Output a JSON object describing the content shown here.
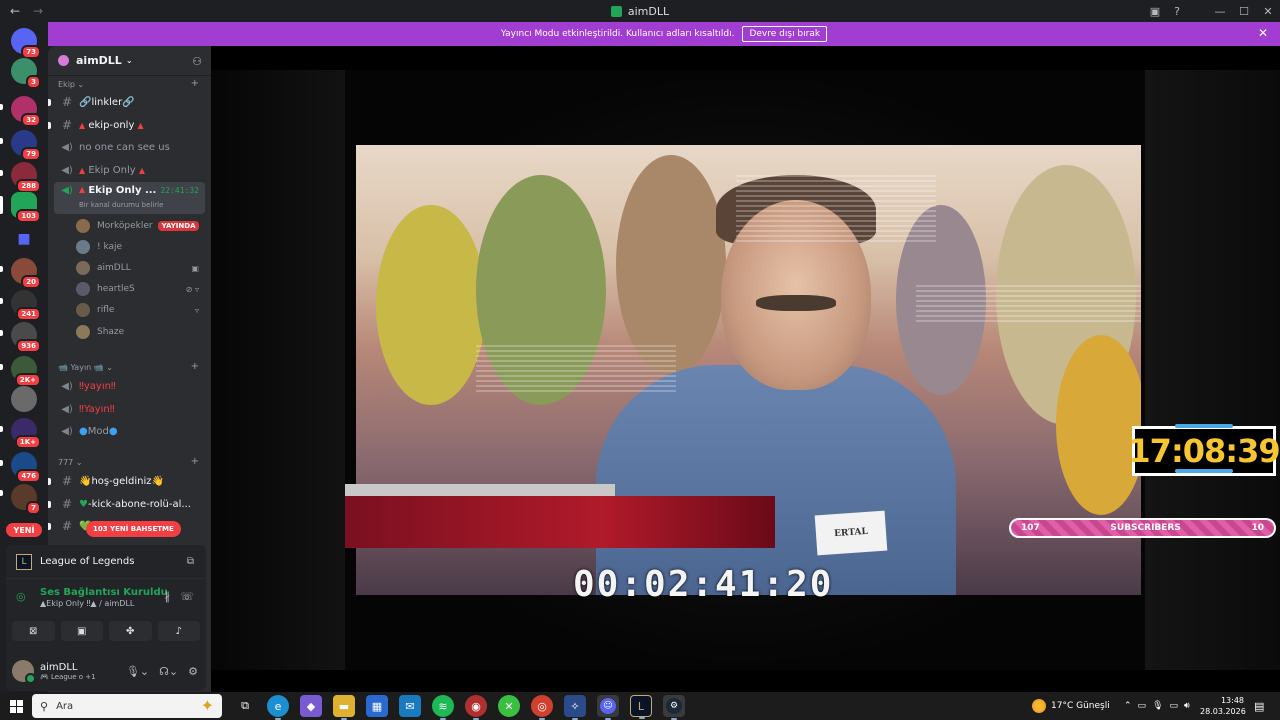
{
  "window": {
    "title": "aimDLL",
    "back": "←",
    "forward": "→",
    "inbox_icon": "inbox-icon",
    "help_icon": "help-icon",
    "minimize": "—",
    "maximize": "☐",
    "close": "✕"
  },
  "banner": {
    "text": "Yayıncı Modu etkinleştirildi. Kullanıcı adları kısaltıldı.",
    "button": "Devre dışı bırak",
    "close": "✕",
    "color": "#a23dd1"
  },
  "guilds": [
    {
      "badge": "73",
      "color": "#5865f2"
    },
    {
      "badge": "3",
      "color": "#3b8f6a"
    },
    {
      "badge": "32",
      "color": "#b0306a"
    },
    {
      "badge": "79",
      "color": "#2a3a8a"
    },
    {
      "badge": "288",
      "color": "#8a2a3a"
    },
    {
      "badge": "103",
      "color": "#23a559"
    },
    {
      "badge": "",
      "color": "#5865f2"
    },
    {
      "badge": "20",
      "color": "#8a4a3a"
    },
    {
      "badge": "241",
      "color": "#333333"
    },
    {
      "badge": "936",
      "color": "#4a4a4a"
    },
    {
      "badge": "2K+",
      "color": "#3a5a3a"
    },
    {
      "badge": "",
      "color": "#6a6a6a"
    },
    {
      "badge": "1K+",
      "color": "#3a2a6a"
    },
    {
      "badge": "476",
      "color": "#1a4a8a"
    },
    {
      "badge": "7",
      "color": "#5a3a2a"
    }
  ],
  "yeni_label": "YENİ",
  "server": {
    "name": "aimDLL",
    "chevron": "⌄",
    "add_person": "+"
  },
  "categories": {
    "ekip": "Ekip",
    "yayin": "Yayın",
    "c777": "777"
  },
  "channels": {
    "linkler": "🔗linkler🔗",
    "ekip_only": "ekip-only",
    "no_one": "no one can see us",
    "ekip_only_voice": "Ekip Only",
    "ekip_only_active": "Ekip Only ...",
    "active_time": "22:41:32",
    "active_sub": "Bir kanal durumu belirle",
    "yayin1": "‼yayın‼",
    "yayin2": "‼Yayın‼",
    "mod": "Mod",
    "hos": "👋hoş-geldiniz👋",
    "kick": "-kick-abone-rolü-al...",
    "last": "💚"
  },
  "members": [
    {
      "name": "Morköpekler",
      "live": "YAYINDA",
      "color": "#8a6a4a",
      "icon": ""
    },
    {
      "name": "! kaje",
      "live": "",
      "color": "#6a7a8a",
      "icon": ""
    },
    {
      "name": "aimDLL",
      "live": "",
      "color": "#7a6a5a",
      "icon": "🎮"
    },
    {
      "name": "heartleS",
      "live": "",
      "color": "#5a5a6a",
      "icon": "🔇"
    },
    {
      "name": "rifle",
      "live": "",
      "color": "#6a5a4a",
      "icon": "🔇"
    },
    {
      "name": "Shaze",
      "live": "",
      "color": "#8a7a5a",
      "icon": ""
    }
  ],
  "new_messages": "103 YENİ BAHSETME",
  "activity": {
    "game": "League of Legends",
    "lol_glyph": "L"
  },
  "voice": {
    "status": "Ses Bağlantısı Kuruldu",
    "channel": "▲Ekip Only ‼▲ / aimDLL"
  },
  "user": {
    "name": "aimDLL",
    "status": "🎮 League o +1"
  },
  "stream": {
    "timer": "00:02:41:20",
    "nametag": "ERTAL",
    "clock": "17:08:39",
    "subs_left": "107",
    "subs_label": "SUBSCRIBERS",
    "subs_right": "10"
  },
  "taskbar": {
    "search_placeholder": "Ara",
    "weather": "17°C  Güneşli",
    "time": "13:48",
    "date": "28.03.2026"
  }
}
